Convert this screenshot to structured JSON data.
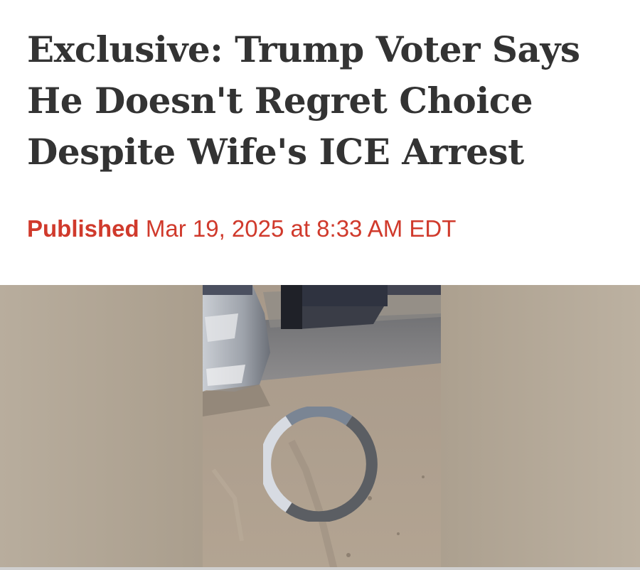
{
  "article": {
    "headline": "Exclusive: Trump Voter Says He Doesn't Regret Choice Despite Wife's ICE Arrest",
    "published_label": "Published",
    "published_date": "Mar 19, 2025 at 8:33 AM EDT"
  },
  "video": {
    "state": "loading",
    "spinner_icon": "loading-spinner-icon",
    "colors": {
      "sand": "#b2a696",
      "spinner_light": "#d7dbe2",
      "spinner_mid": "#7a8594",
      "spinner_dark": "#5b5e63"
    }
  },
  "theme": {
    "headline_color": "#333333",
    "byline_color": "#d03a2c",
    "background": "#ffffff"
  }
}
